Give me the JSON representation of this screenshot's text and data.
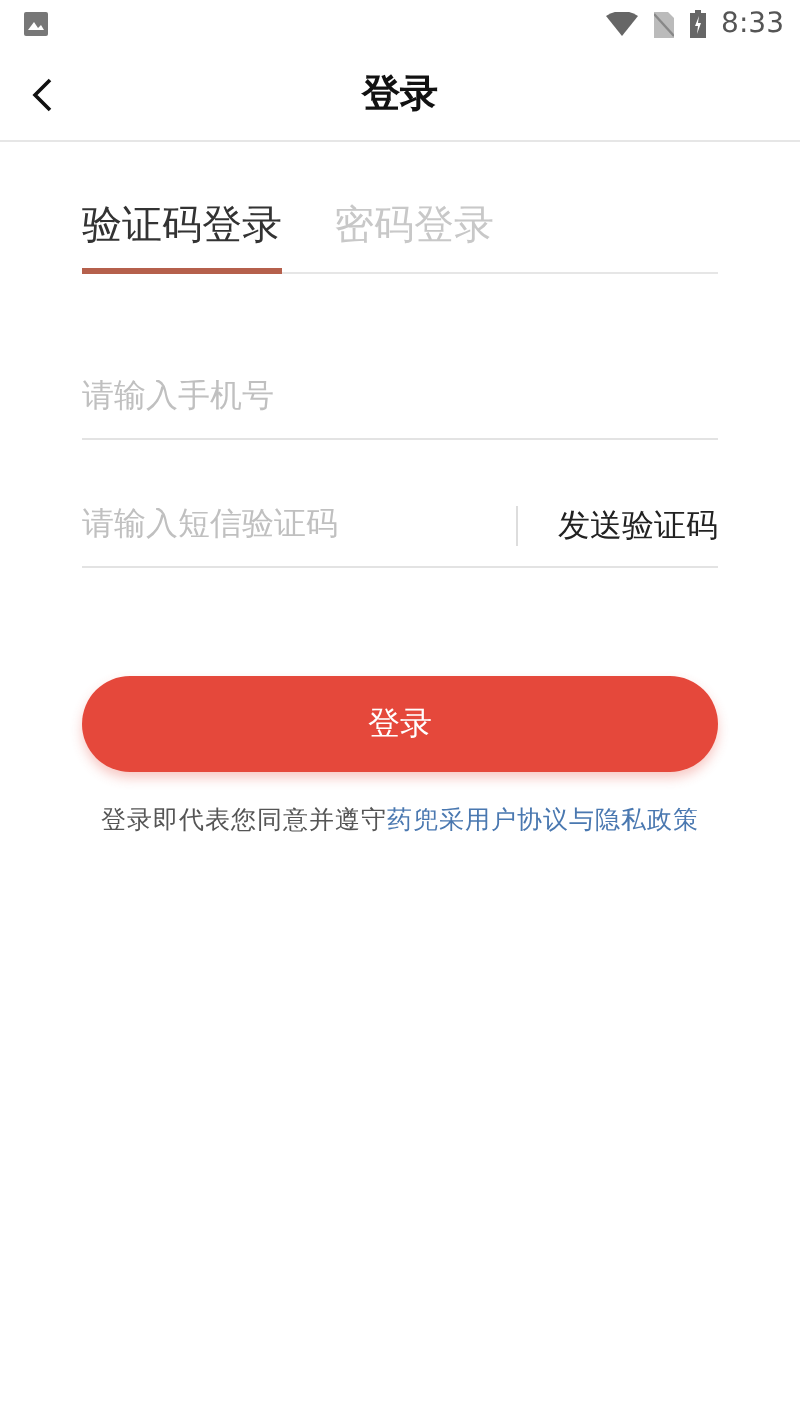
{
  "status_bar": {
    "time": "8:33"
  },
  "header": {
    "title": "登录"
  },
  "tabs": [
    {
      "label": "验证码登录",
      "selected": true
    },
    {
      "label": "密码登录",
      "selected": false
    }
  ],
  "phone_field": {
    "placeholder": "请输入手机号"
  },
  "code_field": {
    "placeholder": "请输入短信验证码",
    "send_button": "发送验证码"
  },
  "login_button": "登录",
  "agreement": {
    "text": "登录即代表您同意并遵守",
    "link": "药兜采用户协议与隐私政策"
  }
}
